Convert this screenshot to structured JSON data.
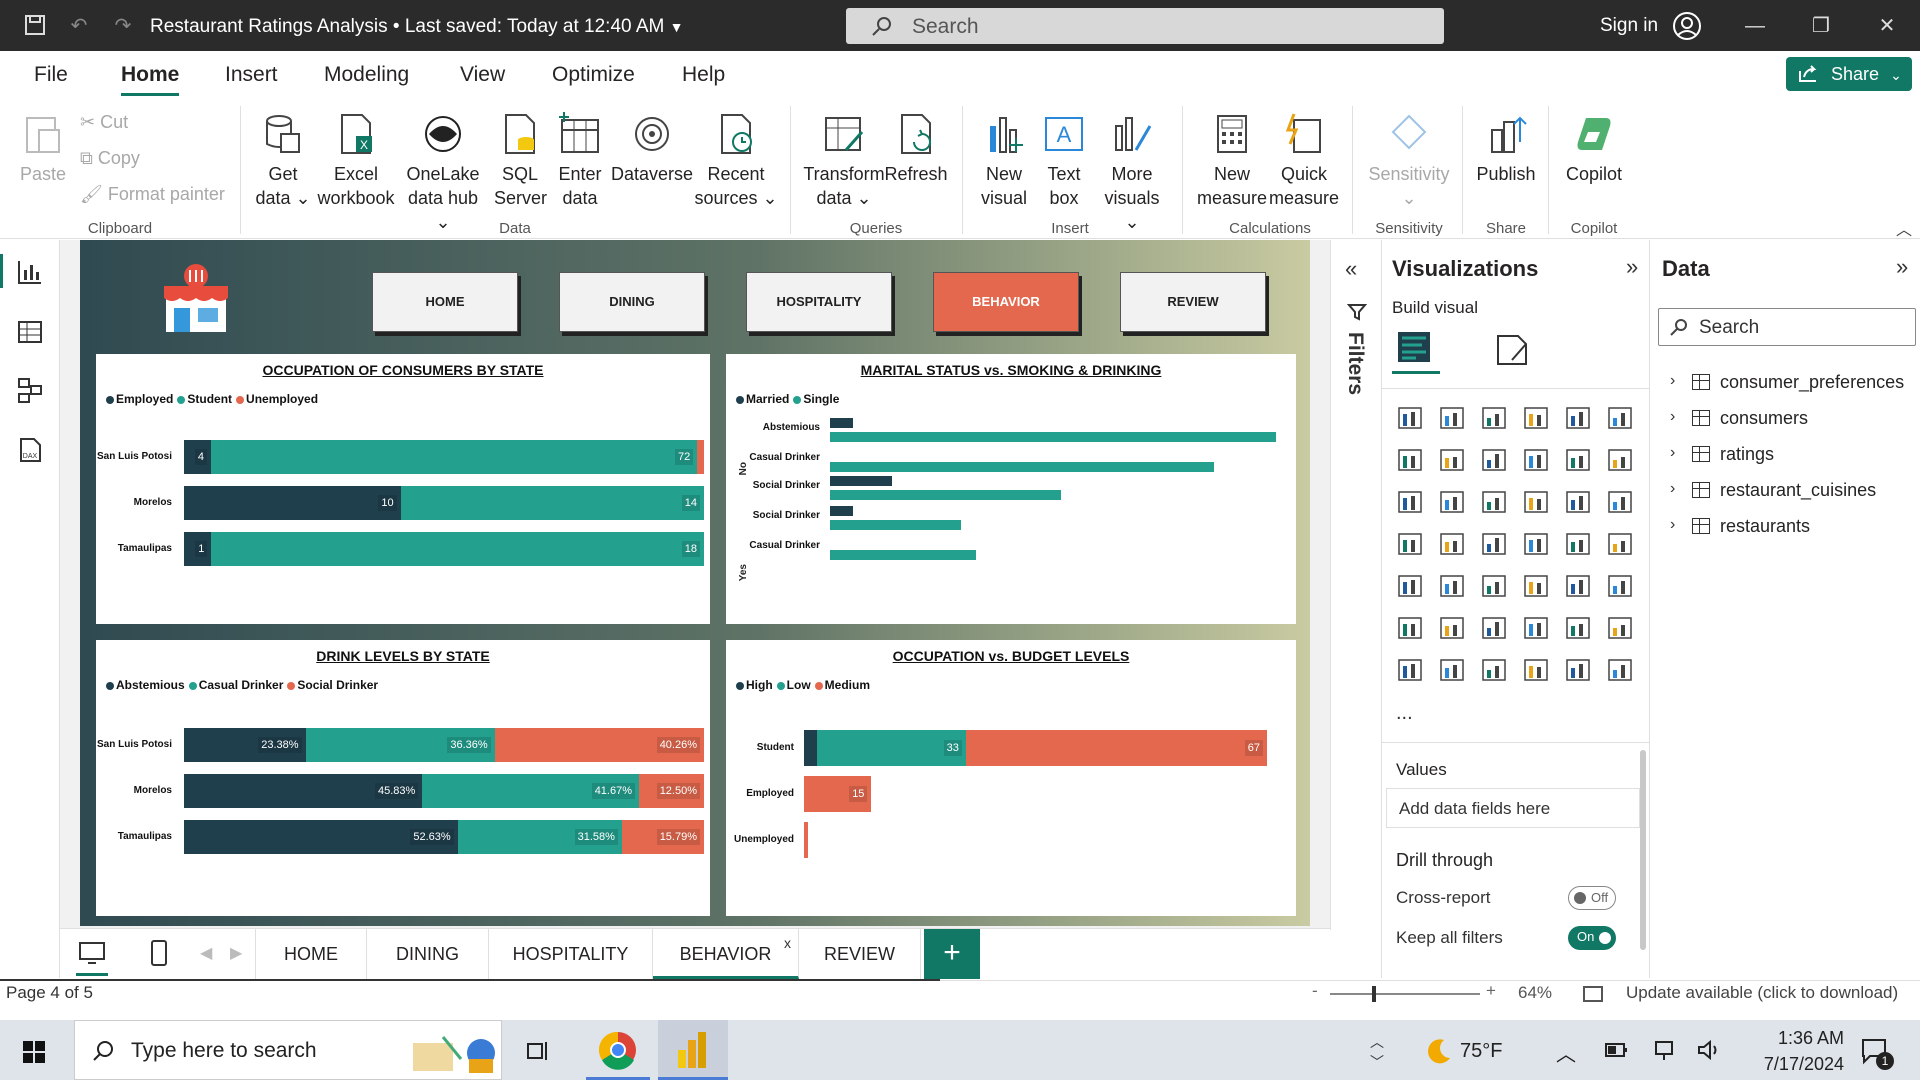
{
  "titlebar": {
    "title": "Restaurant Ratings Analysis",
    "saved": "• Last saved: Today at 12:40 AM",
    "search_placeholder": "Search",
    "signin": "Sign in"
  },
  "menu": {
    "items": [
      "File",
      "Home",
      "Insert",
      "Modeling",
      "View",
      "Optimize",
      "Help"
    ],
    "active": "Home",
    "share": "Share"
  },
  "ribbon": {
    "clipboard": {
      "paste": "Paste",
      "cut": "Cut",
      "copy": "Copy",
      "format_painter": "Format painter",
      "group": "Clipboard"
    },
    "data": {
      "get_data": [
        "Get",
        "data ⌄"
      ],
      "excel": [
        "Excel",
        "workbook"
      ],
      "onelake": [
        "OneLake",
        "data hub ⌄"
      ],
      "sql": [
        "SQL",
        "Server"
      ],
      "enter": [
        "Enter",
        "data"
      ],
      "dataverse": [
        "Dataverse",
        ""
      ],
      "recent": [
        "Recent",
        "sources ⌄"
      ],
      "group": "Data"
    },
    "queries": {
      "transform": [
        "Transform",
        "data ⌄"
      ],
      "refresh": [
        "Refresh",
        ""
      ],
      "group": "Queries"
    },
    "insert": {
      "new_visual": [
        "New",
        "visual"
      ],
      "text_box": [
        "Text",
        "box"
      ],
      "more_visuals": [
        "More",
        "visuals ⌄"
      ],
      "group": "Insert"
    },
    "calculations": {
      "new_measure": [
        "New",
        "measure"
      ],
      "quick_measure": [
        "Quick",
        "measure"
      ],
      "group": "Calculations"
    },
    "sensitivity": {
      "label": [
        "Sensitivity",
        "⌄"
      ],
      "group": "Sensitivity"
    },
    "share": {
      "publish": "Publish",
      "group": "Share"
    },
    "copilot": {
      "label": "Copilot",
      "group": "Copilot"
    }
  },
  "report": {
    "nav_buttons": [
      "HOME",
      "DINING",
      "HOSPITALITY",
      "BEHAVIOR",
      "REVIEW"
    ],
    "active_nav": "BEHAVIOR",
    "colors": {
      "dark": "#1f3f4d",
      "teal": "#23a08e",
      "orange": "#e4684d"
    }
  },
  "chart_data": [
    {
      "type": "bar",
      "title": "OCCUPATION OF CONSUMERS BY STATE",
      "stacked": "100%",
      "categories": [
        "San Luis Potosi",
        "Morelos",
        "Tamaulipas"
      ],
      "series": [
        {
          "name": "Employed",
          "values": [
            4,
            10,
            1
          ],
          "color": "#1f3f4d"
        },
        {
          "name": "Student",
          "values": [
            72,
            14,
            18
          ],
          "color": "#23a08e"
        },
        {
          "name": "Unemployed",
          "values": [
            1,
            0,
            0
          ],
          "color": "#e4684d"
        }
      ]
    },
    {
      "type": "bar",
      "title": "MARITAL STATUS vs. SMOKING & DRINKING",
      "categories": [
        "Abstemious",
        "Casual Drinker",
        "Social Drinker",
        "Social Drinker",
        "Casual Drinker"
      ],
      "group_labels": [
        "No",
        "Yes"
      ],
      "series": [
        {
          "name": "Married",
          "values": [
            3,
            0,
            8,
            3,
            0
          ],
          "color": "#1f3f4d"
        },
        {
          "name": "Single",
          "values": [
            58,
            50,
            30,
            17,
            19
          ],
          "color": "#23a08e"
        }
      ]
    },
    {
      "type": "bar",
      "title": "DRINK LEVELS BY STATE",
      "stacked": "100%",
      "categories": [
        "San Luis Potosi",
        "Morelos",
        "Tamaulipas"
      ],
      "series": [
        {
          "name": "Abstemious",
          "values": [
            23.38,
            45.83,
            52.63
          ],
          "labels": [
            "23.38%",
            "45.83%",
            "52.63%"
          ],
          "color": "#1f3f4d"
        },
        {
          "name": "Casual Drinker",
          "values": [
            36.36,
            41.67,
            31.58
          ],
          "labels": [
            "36.36%",
            "41.67%",
            "31.58%"
          ],
          "color": "#23a08e"
        },
        {
          "name": "Social Drinker",
          "values": [
            40.26,
            12.5,
            15.79
          ],
          "labels": [
            "40.26%",
            "12.50%",
            "15.79%"
          ],
          "color": "#e4684d"
        }
      ]
    },
    {
      "type": "bar",
      "title": "OCCUPATION vs. BUDGET LEVELS",
      "categories": [
        "Student",
        "Employed",
        "Unemployed"
      ],
      "series": [
        {
          "name": "High",
          "values": [
            3,
            0,
            0
          ],
          "color": "#1f3f4d"
        },
        {
          "name": "Low",
          "values": [
            33,
            0,
            0
          ],
          "color": "#23a08e"
        },
        {
          "name": "Medium",
          "values": [
            67,
            15,
            1
          ],
          "color": "#e4684d"
        }
      ],
      "xlim": [
        0,
        105
      ]
    }
  ],
  "filters": {
    "label": "Filters"
  },
  "visualizations": {
    "title": "Visualizations",
    "build": "Build visual",
    "values": "Values",
    "add_fields": "Add data fields here",
    "drill": "Drill through",
    "cross_report": "Cross-report",
    "cross_state": "Off",
    "keep_filters": "Keep all filters",
    "keep_state": "On",
    "more": "..."
  },
  "data_pane": {
    "title": "Data",
    "search_placeholder": "Search",
    "tables": [
      "consumer_preferences",
      "consumers",
      "ratings",
      "restaurant_cuisines",
      "restaurants"
    ]
  },
  "tabs": {
    "pages": [
      "HOME",
      "DINING",
      "HOSPITALITY",
      "BEHAVIOR",
      "REVIEW"
    ],
    "active": "BEHAVIOR",
    "close": "x"
  },
  "status": {
    "page": "Page 4 of 5",
    "zoom": "64%",
    "update": "Update available (click to download)"
  },
  "taskbar": {
    "search": "Type here to search",
    "weather": "75°F",
    "time": "1:36 AM",
    "date": "7/17/2024",
    "notif": "1"
  }
}
